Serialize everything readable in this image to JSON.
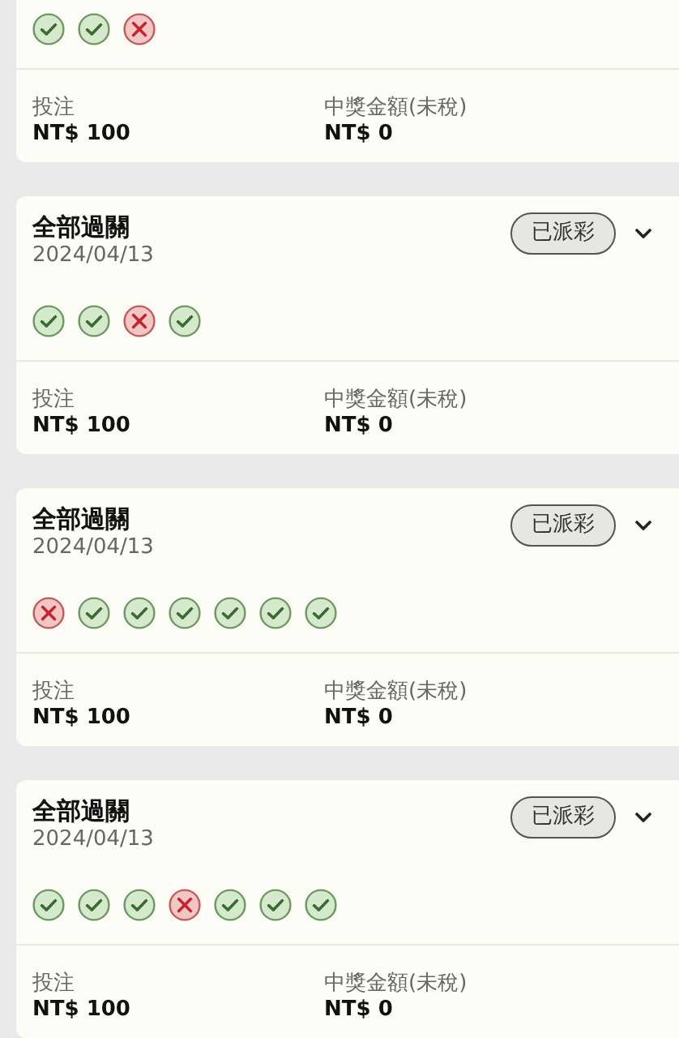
{
  "bets": [
    {
      "results": [
        {
          "kind": "win"
        },
        {
          "kind": "win"
        },
        {
          "kind": "loss"
        }
      ],
      "stake_label": "投注",
      "stake": "NT$ 100",
      "prize_label": "中獎金額(未稅)",
      "prize": "NT$ 0"
    },
    {
      "title": "全部過關",
      "date": "2024/04/13",
      "status": "已派彩",
      "results": [
        {
          "kind": "win"
        },
        {
          "kind": "win"
        },
        {
          "kind": "loss"
        },
        {
          "kind": "win"
        }
      ],
      "stake_label": "投注",
      "stake": "NT$ 100",
      "prize_label": "中獎金額(未稅)",
      "prize": "NT$ 0"
    },
    {
      "title": "全部過關",
      "date": "2024/04/13",
      "status": "已派彩",
      "results": [
        {
          "kind": "loss"
        },
        {
          "kind": "win"
        },
        {
          "kind": "win"
        },
        {
          "kind": "win"
        },
        {
          "kind": "win"
        },
        {
          "kind": "win"
        },
        {
          "kind": "win"
        }
      ],
      "stake_label": "投注",
      "stake": "NT$ 100",
      "prize_label": "中獎金額(未稅)",
      "prize": "NT$ 0"
    },
    {
      "title": "全部過關",
      "date": "2024/04/13",
      "status": "已派彩",
      "results": [
        {
          "kind": "win"
        },
        {
          "kind": "win"
        },
        {
          "kind": "win"
        },
        {
          "kind": "loss"
        },
        {
          "kind": "win"
        },
        {
          "kind": "win"
        },
        {
          "kind": "win"
        }
      ],
      "stake_label": "投注",
      "stake": "NT$ 100",
      "prize_label": "中獎金額(未稅)",
      "prize": "NT$ 0"
    }
  ]
}
